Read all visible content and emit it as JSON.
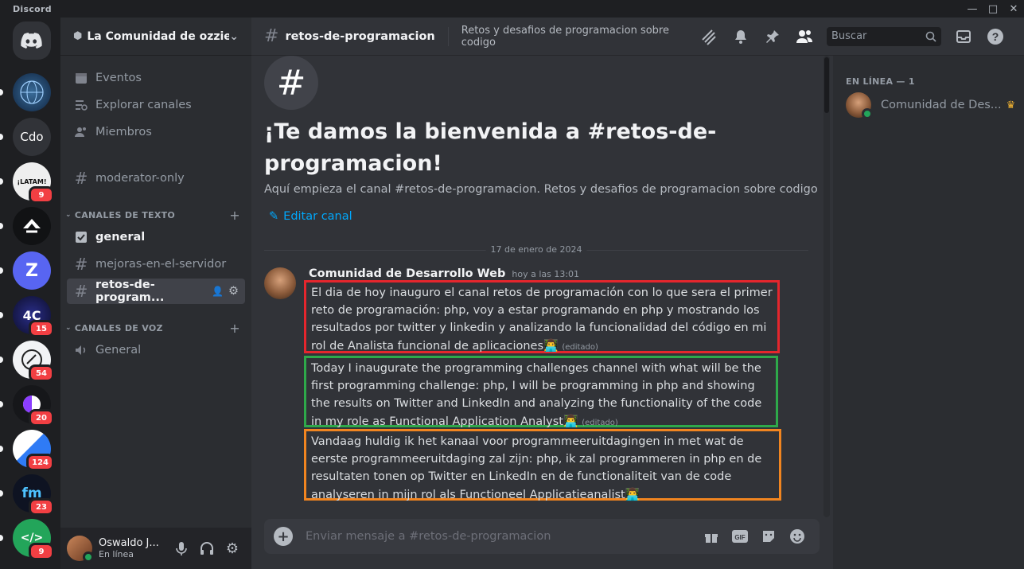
{
  "app": {
    "title": "Discord"
  },
  "servers": [
    {
      "label": "",
      "icon": "discord-home-icon",
      "color": "#313338"
    },
    {
      "label": "",
      "icon": "globe-server-icon",
      "color": "#1d3a5c",
      "badge": ""
    },
    {
      "label": "Cdo",
      "color": "#313338",
      "badge": ""
    },
    {
      "label": "¡LATAM!",
      "color": "#efefef",
      "badge": "9"
    },
    {
      "label": "",
      "color": "#111214",
      "badge": ""
    },
    {
      "label": "Z",
      "color": "#5865f2",
      "badge": ""
    },
    {
      "label": "4C",
      "color": "#1b1d4f",
      "badge": "15"
    },
    {
      "label": "",
      "color": "#f2f3f5",
      "badge": "54"
    },
    {
      "label": "",
      "color": "#16171a",
      "badge": "20"
    },
    {
      "label": "",
      "color": "#2f7bf5",
      "badge": "124"
    },
    {
      "label": "fm",
      "color": "#0e1322",
      "badge": "23"
    },
    {
      "label": "</>",
      "color": "#23a55a",
      "badge": "9"
    }
  ],
  "sidebar": {
    "server_name": "La Comunidad de ozzie’s",
    "top_items": [
      {
        "label": "Eventos",
        "icon": "calendar-icon"
      },
      {
        "label": "Explorar canales",
        "icon": "browse-channels-icon"
      },
      {
        "label": "Miembros",
        "icon": "members-icon"
      }
    ],
    "moderator_channel": "moderator-only",
    "text_category": "CANALES DE TEXTO",
    "text_channels": [
      {
        "label": "general",
        "icon": "rules-icon"
      },
      {
        "label": "mejoras-en-el-servidor",
        "icon": "hash-icon"
      },
      {
        "label": "retos-de-program...",
        "icon": "hash-icon"
      }
    ],
    "voice_category": "CANALES DE VOZ",
    "voice_channels": [
      {
        "label": "General",
        "icon": "speaker-icon"
      }
    ]
  },
  "user": {
    "name": "Oswaldo J...",
    "status": "En línea"
  },
  "channel": {
    "name": "retos-de-programacion",
    "topic": "Retos y desafios de programacion sobre codigo",
    "search_placeholder": "Buscar"
  },
  "welcome": {
    "title": "¡Te damos la bienvenida a #retos-de-programacion!",
    "subtitle": "Aquí empieza el canal #retos-de-programacion. Retos y desafios de programacion sobre codigo",
    "edit_label": "Editar canal"
  },
  "date_divider": "17 de enero de 2024",
  "message": {
    "author": "Comunidad de Desarrollo Web",
    "timestamp": "hoy a las 13:01",
    "edited_label": "(editado)",
    "emoji": "👨‍💻",
    "lines": [
      "El dia de hoy inauguro el canal retos de programación con lo que sera el primer reto de programación: php, voy a estar programando en php y mostrando los resultados por twitter y linkedin y analizando la funcionalidad del código en mi rol de Analista funcional de aplicaciones",
      "Today I inaugurate the programming challenges channel with what will be the first programming challenge: php, I will be programming in php and showing the results on Twitter and LinkedIn and analyzing the functionality of the code in my role as Functional Application Analyst",
      "Vandaag huldig ik het kanaal voor programmeeruitdagingen in met wat de eerste programmeeruitdaging zal zijn: php, ik zal programmeren in php en de resultaten tonen op Twitter en LinkedIn en de functionaliteit van de code analyseren in mijn rol als Functioneel Applicatieanalist"
    ]
  },
  "composer": {
    "placeholder": "Enviar mensaje a #retos-de-programacion"
  },
  "members": {
    "header": "EN LÍNEA — 1",
    "list": [
      {
        "name": "Comunidad de Des..."
      }
    ]
  },
  "colors": {
    "blurple": "#5865f2",
    "online": "#23a55a",
    "danger": "#f23f43",
    "link": "#00a8fc"
  }
}
